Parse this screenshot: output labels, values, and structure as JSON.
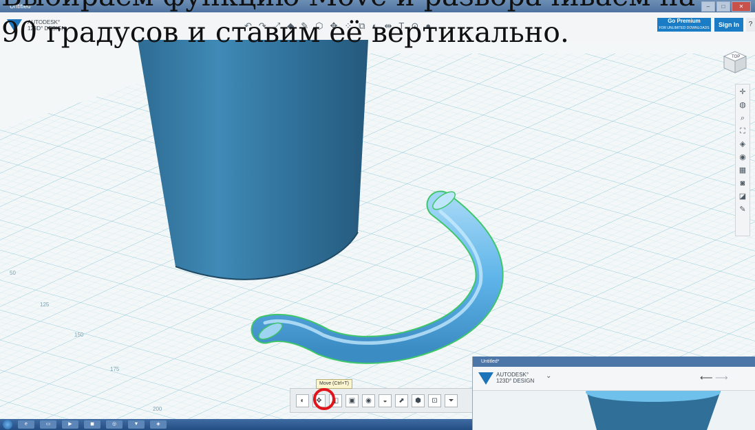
{
  "window": {
    "title": "Untitled*"
  },
  "header": {
    "brand_line1": "AUTODESK°",
    "brand_line2": "123D° DESIGN",
    "premium_label": "Go Premium",
    "premium_sub": "FOR UNLIMITED DOWNLOADS",
    "signin_label": "Sign In",
    "help_label": "?"
  },
  "caption": {
    "line1": "Выбираем функцию Move и разворачиваем на",
    "line2": "90 градусов и ставим её вертикально."
  },
  "viewcube": {
    "label": "TOP"
  },
  "tooltip": {
    "text": "Move (Ctrl+T)"
  },
  "grid_labels": [
    "50",
    "125",
    "150",
    "175",
    "200"
  ],
  "inset": {
    "title": "Untitled*",
    "brand_line1": "AUTODESK°",
    "brand_line2": "123D° DESIGN"
  },
  "colors": {
    "accent": "#1a7cc4",
    "cylinder": "#3b7fa8",
    "torus": "#5eb3e8",
    "selection_edge": "#3fc66a",
    "grid": "#a6d7e3",
    "highlight_ring": "#e0141b"
  }
}
